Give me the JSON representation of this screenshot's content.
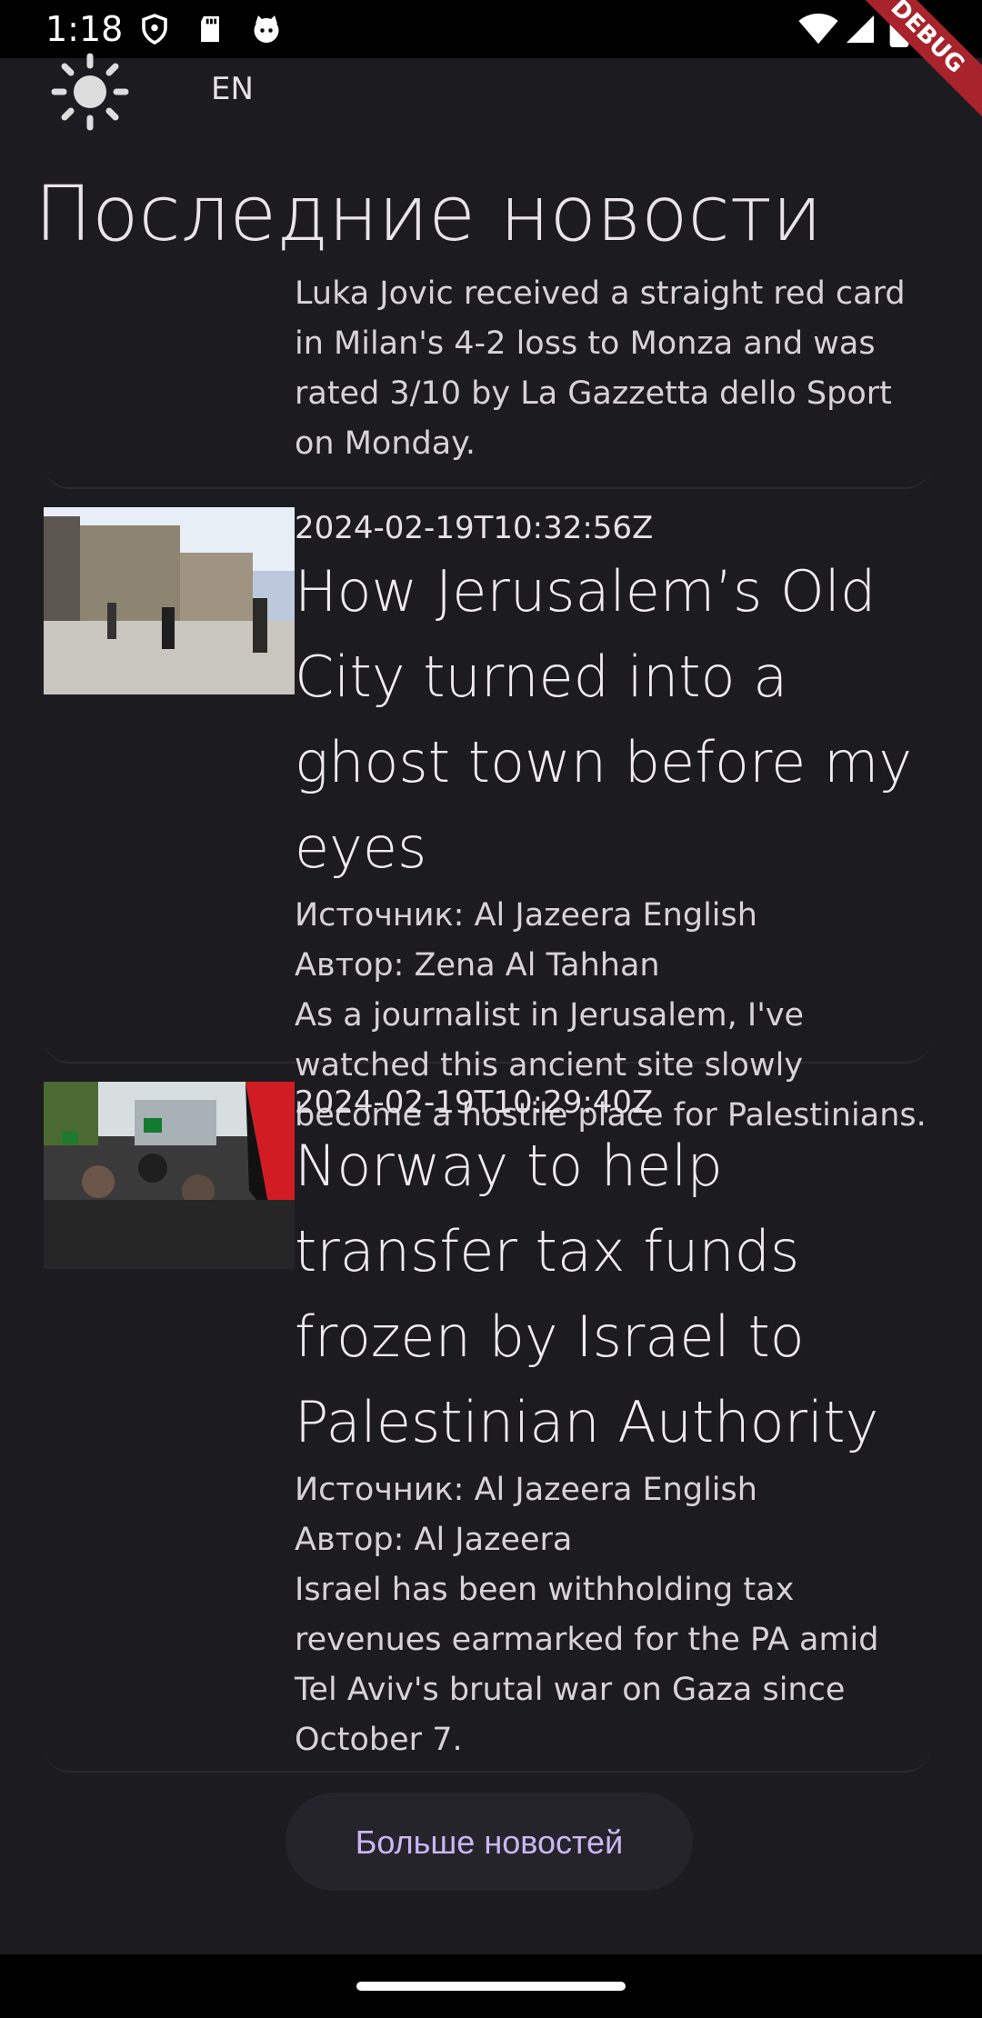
{
  "status_bar": {
    "time": "1:18",
    "debug_label": "DEBUG"
  },
  "header": {
    "theme_icon": "sun-icon",
    "language": "EN",
    "title": "Последние новости"
  },
  "partial_article": {
    "summary": "Luka Jovic received a straight red card in Milan's 4-2 loss to Monza and was rated 3/10 by La Gazzetta dello Sport on Monday."
  },
  "articles": [
    {
      "date": "2024-02-19T10:32:56Z",
      "title": "How Jerusalem’s Old City turned into a ghost town before my eyes",
      "source": "Источник: Al Jazeera English",
      "author": "Автор: Zena Al Tahhan",
      "summary": "As a journalist in Jerusalem, I've watched this ancient site slowly become a hostile place for Palestinians."
    },
    {
      "date": "2024-02-19T10:29:40Z",
      "title": "Norway to help transfer tax funds frozen by Israel to Palestinian Authority",
      "source": "Источник: Al Jazeera English",
      "author": "Автор: Al Jazeera",
      "summary": "Israel has been withholding tax revenues earmarked for the PA amid Tel Aviv's brutal war on Gaza since October 7."
    }
  ],
  "more_button": "Больше новостей",
  "colors": {
    "background": "#1c1b20",
    "accent": "#c9b7f2",
    "debug": "#a8232b"
  }
}
